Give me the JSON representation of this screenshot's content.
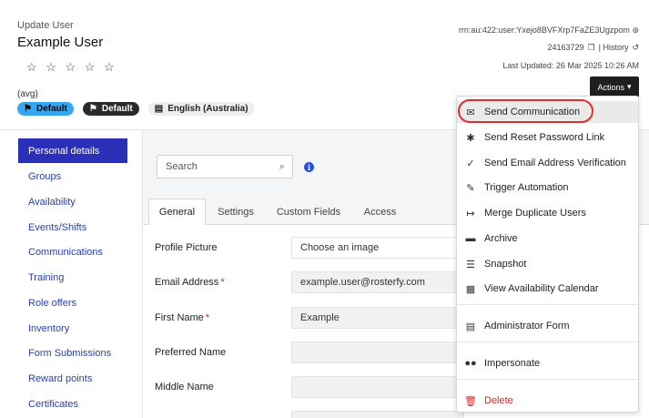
{
  "header": {
    "label": "Update User",
    "title": "Example User",
    "stars": "☆ ☆ ☆ ☆ ☆",
    "avg": "(avg)",
    "badges": [
      "Default",
      "Default",
      "English (Australia)"
    ],
    "rrn": "rrn:au:422:user:Yxejo8BVFXrp7FaZE3Ugzpom",
    "user_id": "24163729",
    "history": "| History",
    "last_updated": "Last Updated: 26 Mar 2025 10:26 AM",
    "actions_label": "Actions"
  },
  "sidebar": {
    "items": [
      "Personal details",
      "Groups",
      "Availability",
      "Events/Shifts",
      "Communications",
      "Training",
      "Role offers",
      "Inventory",
      "Form Submissions",
      "Reward points",
      "Certificates"
    ]
  },
  "search": {
    "placeholder": "Search"
  },
  "tabs": [
    "General",
    "Settings",
    "Custom Fields",
    "Access"
  ],
  "form": {
    "fields": [
      {
        "label": "Profile Picture",
        "value": "Choose an image",
        "required": ""
      },
      {
        "label": "Email Address",
        "value": "example.user@rosterfy.com",
        "required": "*"
      },
      {
        "label": "First Name",
        "value": "Example",
        "required": "*"
      },
      {
        "label": "Preferred Name",
        "value": "",
        "required": ""
      },
      {
        "label": "Middle Name",
        "value": "",
        "required": ""
      }
    ]
  },
  "actions_menu": {
    "items": [
      {
        "label": "Send Communication",
        "icon": "envelope-icon"
      },
      {
        "label": "Send Reset Password Link",
        "icon": "asterisk-icon"
      },
      {
        "label": "Send Email Address Verification",
        "icon": "check-icon"
      },
      {
        "label": "Trigger Automation",
        "icon": "pencil-icon"
      },
      {
        "label": "Merge Duplicate Users",
        "icon": "merge-icon"
      },
      {
        "label": "Archive",
        "icon": "archive-icon"
      },
      {
        "label": "Snapshot",
        "icon": "checklist-icon"
      },
      {
        "label": "View Availability Calendar",
        "icon": "calendar-icon"
      },
      {
        "label": "Administrator Form",
        "icon": "clipboard-icon"
      },
      {
        "label": "Impersonate",
        "icon": "mask-icon"
      },
      {
        "label": "Delete",
        "icon": "trash-icon"
      }
    ]
  },
  "colors": {
    "accent": "#2b2fb8",
    "badge_blue": "#35a6f0",
    "danger": "#e02424",
    "highlight_ring": "#e0302d"
  }
}
